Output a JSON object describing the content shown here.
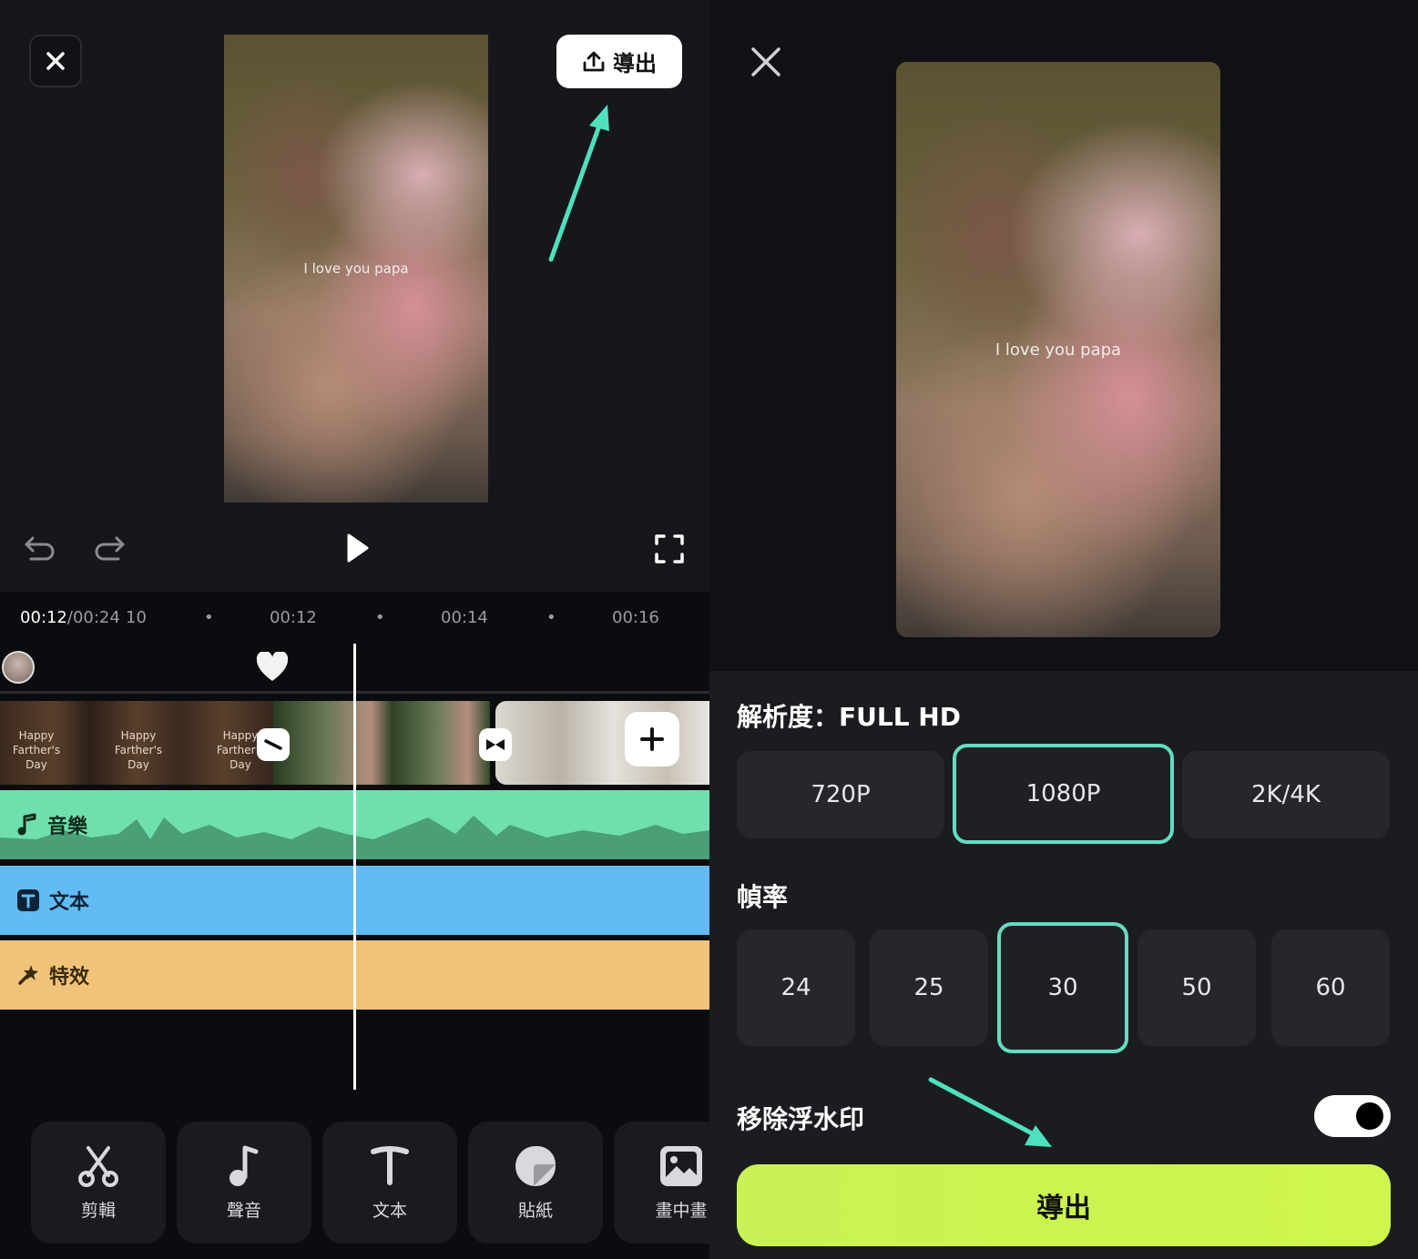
{
  "left": {
    "export_label": "導出",
    "video_caption": "I love you papa",
    "time": {
      "current": "00:12",
      "total": "/00:24",
      "frame": "10",
      "marks": [
        "00:12",
        "00:14",
        "00:16"
      ]
    },
    "filmstrip_text": "Happy Farther's Day",
    "tracks": {
      "music": "音樂",
      "text": "文本",
      "effects": "特效"
    },
    "tools": [
      {
        "label": "剪輯",
        "icon": "scissors-icon"
      },
      {
        "label": "聲音",
        "icon": "music-note-icon"
      },
      {
        "label": "文本",
        "icon": "text-t-icon"
      },
      {
        "label": "貼紙",
        "icon": "sticker-icon"
      },
      {
        "label": "畫中畫",
        "icon": "picture-in-picture-icon"
      }
    ],
    "colors": {
      "music_track": "#6fe0ad",
      "text_track": "#62bcf3",
      "effects_track": "#f0c478",
      "arrow": "#4fe0bd"
    }
  },
  "right": {
    "video_caption": "I love you papa",
    "resolution_title": "解析度：FULL HD",
    "resolutions": [
      "720P",
      "1080P",
      "2K/4K"
    ],
    "resolution_selected": "1080P",
    "framerate_title": "幀率",
    "framerates": [
      "24",
      "25",
      "30",
      "50",
      "60"
    ],
    "framerate_selected": "30",
    "watermark_label": "移除浮水印",
    "watermark_toggle_on": true,
    "export_label": "導出",
    "colors": {
      "accent": "#63dcc0",
      "export_button": "#c8f255"
    }
  }
}
